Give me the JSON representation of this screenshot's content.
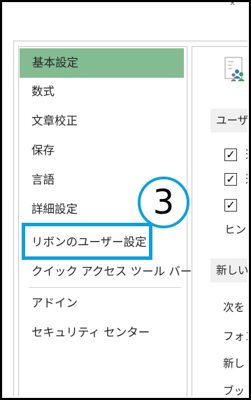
{
  "window": {
    "close_glyph": "✕"
  },
  "nav": {
    "items": [
      {
        "label": "基本設定"
      },
      {
        "label": "数式"
      },
      {
        "label": "文章校正"
      },
      {
        "label": "保存"
      },
      {
        "label": "言語"
      },
      {
        "label": "詳細設定"
      },
      {
        "label": "リボンのユーザー設定"
      },
      {
        "label": "クイック アクセス ツール バー"
      },
      {
        "label": "アドイン"
      },
      {
        "label": "セキュリティ センター"
      }
    ],
    "selected_item": "基本設定"
  },
  "annotation": {
    "step_number": "3",
    "accent_color": "#0ea0dc"
  },
  "content": {
    "icon": "users-options-icon",
    "section1_header": "ユーザ",
    "checkboxes": [
      {
        "checked": true,
        "label": "選"
      },
      {
        "checked": true,
        "label": "選"
      },
      {
        "checked": true,
        "label": "リ"
      }
    ],
    "hint_text": "ヒント",
    "section2_header": "新しい",
    "lines": [
      "次を",
      "フォン",
      "新し",
      "ブッ"
    ]
  },
  "colors": {
    "selected_bg": "#83bc91",
    "section_bg": "#f0f0f0"
  }
}
